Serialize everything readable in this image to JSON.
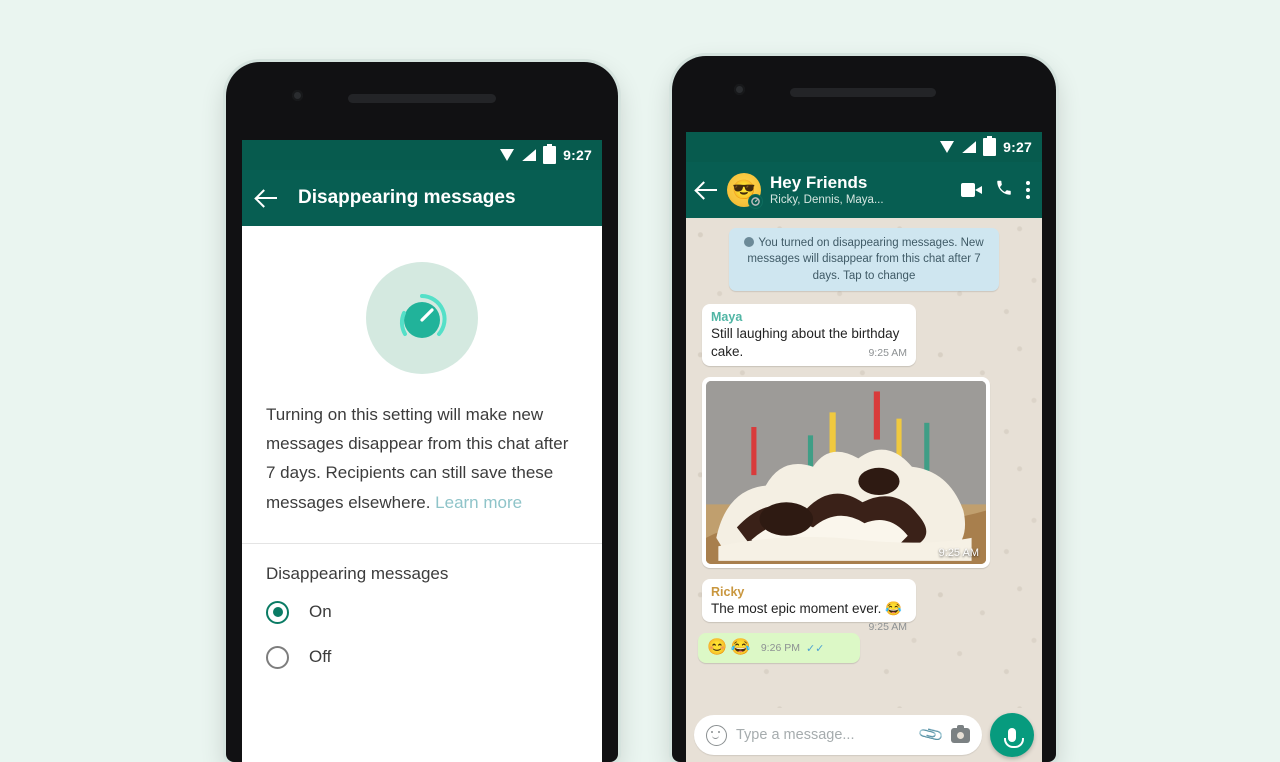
{
  "background_color": "#eaf5f0",
  "brand": {
    "green": "#075e52",
    "status_green": "#075b4e",
    "accent_teal": "#0a7b64",
    "bubble_out": "#dcf8c6"
  },
  "left_phone": {
    "statusbar": {
      "time": "9:27",
      "icons": [
        "wifi-icon",
        "signal-icon",
        "battery-icon"
      ]
    },
    "appbar": {
      "back": "back-arrow-icon",
      "title": "Disappearing messages"
    },
    "hero_icon": "disappearing-timer-icon",
    "description": "Turning on this setting will make new messages disappear from this chat after 7 days. Recipients can still save these messages elsewhere.",
    "learn_more": "Learn more",
    "section_title": "Disappearing messages",
    "options": [
      {
        "label": "On",
        "selected": true
      },
      {
        "label": "Off",
        "selected": false
      }
    ]
  },
  "right_phone": {
    "statusbar": {
      "time": "9:27"
    },
    "chatbar": {
      "back": "back-arrow-icon",
      "avatar_emoji": "😎",
      "title": "Hey Friends",
      "subtitle": "Ricky, Dennis, Maya...",
      "actions": [
        "video-call-icon",
        "voice-call-icon",
        "overflow-menu-icon"
      ]
    },
    "system_note": "You turned on disappearing messages. New messages will disappear from this chat after 7 days. Tap to change",
    "messages": [
      {
        "type": "incoming",
        "sender": "Maya",
        "sender_color": "#50b5a4",
        "text": "Still laughing about the birthday cake.",
        "time": "9:25 AM"
      },
      {
        "type": "image",
        "caption": "birthday-cake-photo",
        "time": "9:25 AM"
      },
      {
        "type": "incoming",
        "sender": "Ricky",
        "sender_color": "#c9973f",
        "text": "The most epic moment ever. 😂",
        "time": "9:25 AM"
      },
      {
        "type": "outgoing",
        "emoji": [
          "😊",
          "😂"
        ],
        "time": "9:26 PM",
        "status": "✓✓"
      }
    ],
    "input": {
      "emoji_icon": "smiley-icon",
      "placeholder": "Type a message...",
      "attach_icon": "paperclip-icon",
      "camera_icon": "camera-icon",
      "mic_icon": "microphone-icon"
    }
  }
}
